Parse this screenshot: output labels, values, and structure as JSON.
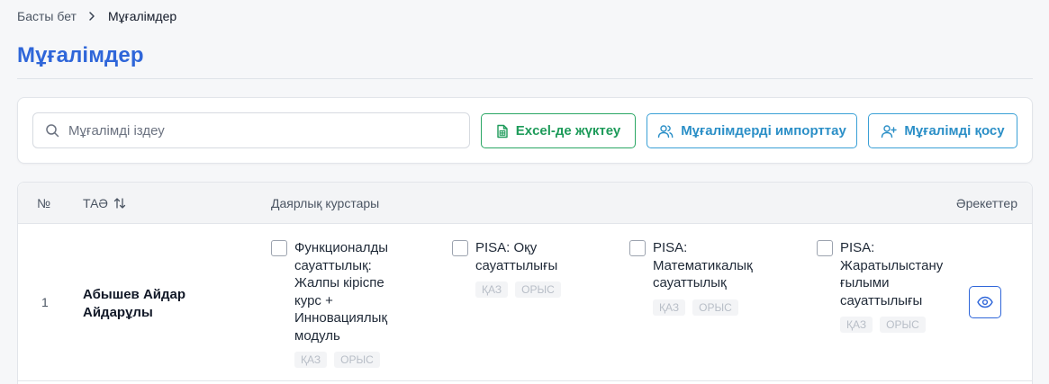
{
  "breadcrumb": {
    "home": "Басты бет",
    "current": "Мұғалімдер"
  },
  "page": {
    "title": "Мұғалімдер"
  },
  "toolbar": {
    "search_placeholder": "Мұғалімді іздеу",
    "excel_label": "Excel-де жүктеу",
    "import_label": "Мұғалімдерді импорттау",
    "add_label": "Мұғалімді қосу"
  },
  "table": {
    "headers": {
      "num": "№",
      "name": "ТАӘ",
      "courses": "Даярлық курстары",
      "actions": "Әрекеттер"
    },
    "rows": [
      {
        "num": "1",
        "name": "Абышев Айдар Айдарұлы",
        "courses": [
          {
            "title": "Функционалды сауаттылық: Жалпы кіріспе курс + Инновациялық модуль",
            "tags": [
              "ҚАЗ",
              "ОРЫС"
            ]
          },
          {
            "title": "PISA: Оқу сауаттылығы",
            "tags": [
              "ҚАЗ",
              "ОРЫС"
            ]
          },
          {
            "title": "PISA: Математикалық сауаттылық",
            "tags": [
              "ҚАЗ",
              "ОРЫС"
            ]
          },
          {
            "title": "PISA: Жаратылыстану ғылыми сауаттылығы",
            "tags": [
              "ҚАЗ",
              "ОРЫС"
            ]
          }
        ]
      }
    ]
  },
  "colors": {
    "primary": "#2f66d9",
    "excel": "#1e9b5a",
    "info": "#2b8fc7"
  }
}
